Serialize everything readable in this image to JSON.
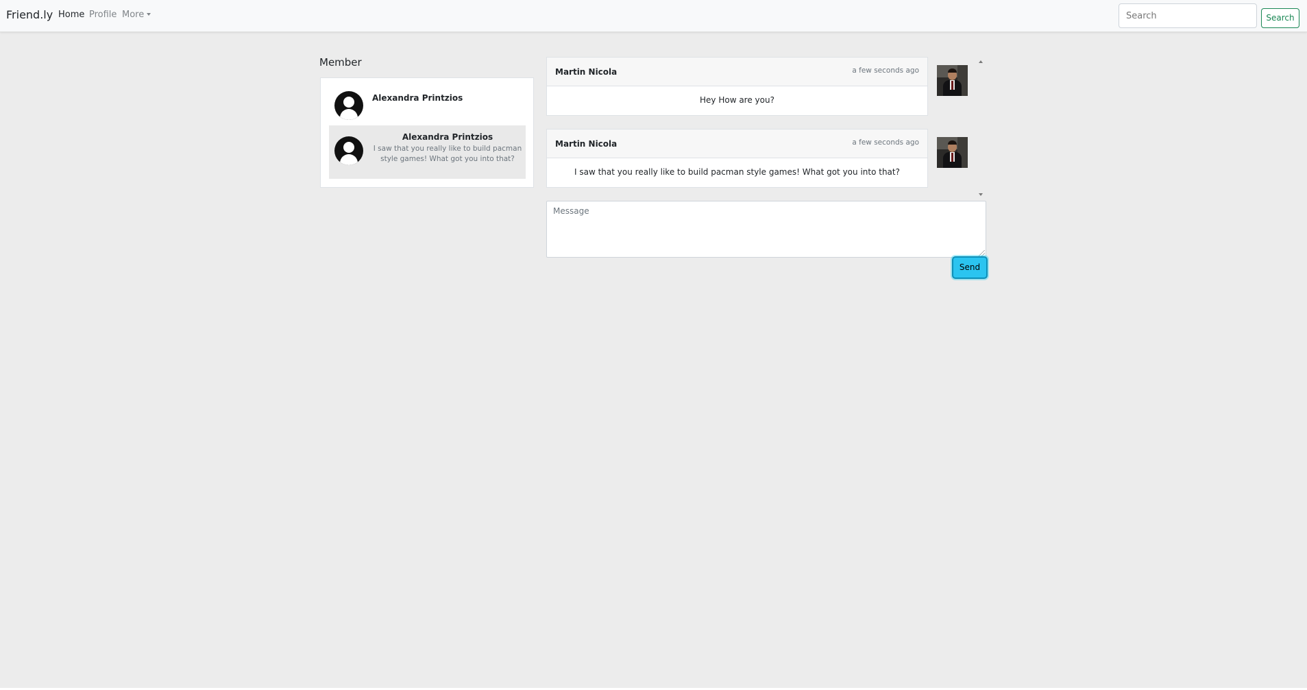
{
  "navbar": {
    "brand": "Friend.ly",
    "links": [
      {
        "label": "Home",
        "active": true
      },
      {
        "label": "Profile",
        "active": false
      },
      {
        "label": "More",
        "active": false,
        "dropdown": true
      }
    ],
    "search_placeholder": "Search",
    "search_button": "Search"
  },
  "members": {
    "heading": "Member",
    "items": [
      {
        "name": "Alexandra Printzios",
        "preview": ""
      },
      {
        "name": "Alexandra Printzios",
        "preview": "I saw that you really like to build pacman style games! What got you into that?",
        "selected": true
      }
    ]
  },
  "messages": [
    {
      "author": "Martin Nicola",
      "time": "a few seconds ago",
      "text": "Hey How are you?"
    },
    {
      "author": "Martin Nicola",
      "time": "a few seconds ago",
      "text": "I saw that you really like to build pacman style games! What got you into that?"
    }
  ],
  "composer": {
    "placeholder": "Message",
    "send_label": "Send"
  },
  "colors": {
    "page_bg": "#ececec",
    "send_button": "#2bc4f0",
    "search_button": "#198754"
  },
  "icons": {
    "member_avatar": "user-circle-icon",
    "message_avatar": "user-photo"
  }
}
